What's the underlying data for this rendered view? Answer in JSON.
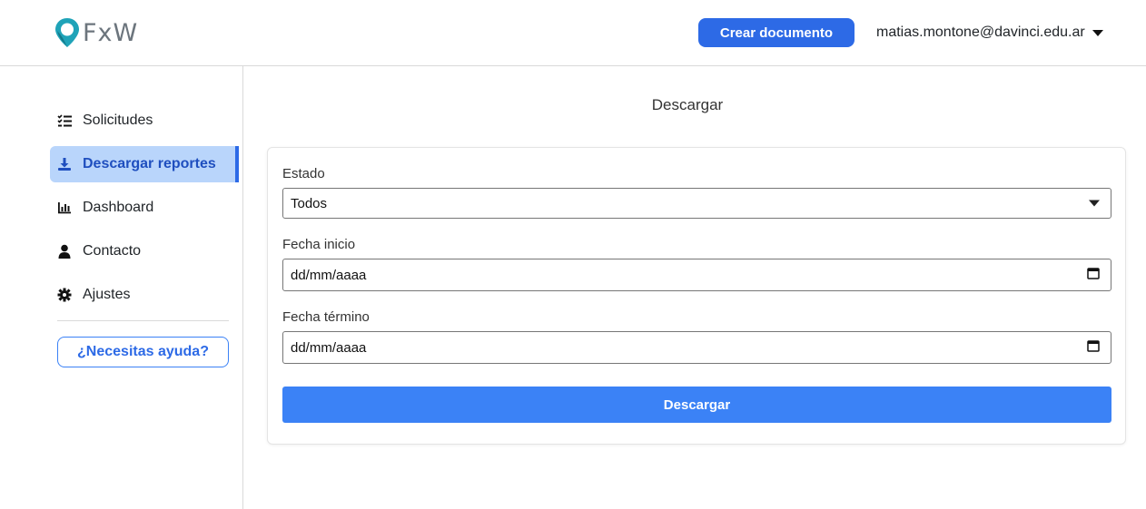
{
  "header": {
    "logo_text": "FxW",
    "create_button": "Crear documento",
    "user_email": "matias.montone@davinci.edu.ar"
  },
  "sidebar": {
    "items": [
      {
        "label": "Solicitudes",
        "icon": "list-check-icon",
        "active": false
      },
      {
        "label": "Descargar reportes",
        "icon": "download-icon",
        "active": true
      },
      {
        "label": "Dashboard",
        "icon": "bar-chart-icon",
        "active": false
      },
      {
        "label": "Contacto",
        "icon": "user-icon",
        "active": false
      },
      {
        "label": "Ajustes",
        "icon": "gear-icon",
        "active": false
      }
    ],
    "help_button": "¿Necesitas ayuda?"
  },
  "main": {
    "title": "Descargar",
    "form": {
      "estado_label": "Estado",
      "estado_value": "Todos",
      "fecha_inicio_label": "Fecha inicio",
      "fecha_inicio_placeholder": "dd/mm/aaaa",
      "fecha_termino_label": "Fecha término",
      "fecha_termino_placeholder": "dd/mm/aaaa",
      "submit_label": "Descargar"
    }
  },
  "colors": {
    "accent": "#2d6ae6",
    "active_bg": "#b9d5fb",
    "submit_bg": "#3b82f6",
    "logo_pin": "#1fa3b8"
  }
}
